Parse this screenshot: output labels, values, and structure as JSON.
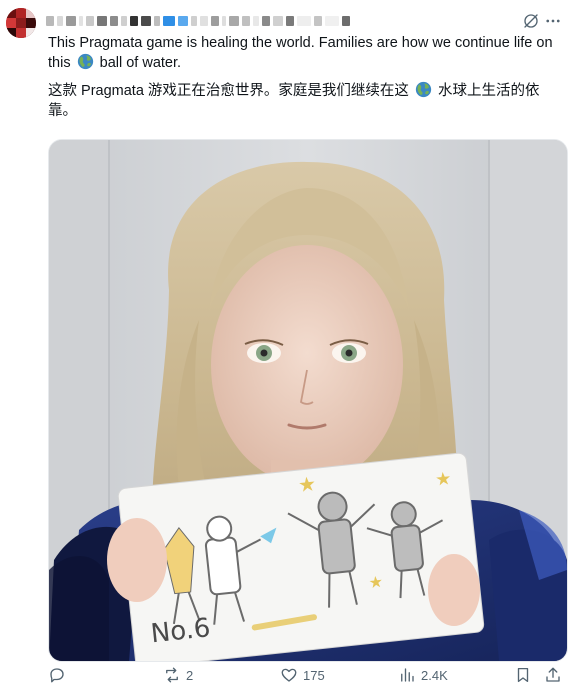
{
  "tweet": {
    "author_name_visible": false,
    "text_en_before_icon": "This Pragmata game is healing the world. Families are how we continue life on this",
    "text_en_after_icon": "ball of water.",
    "text_zh_before_icon": "这款 Pragmata 游戏正在治愈世界。家庭是我们继续在这",
    "text_zh_after_icon": "水球上生活的依靠。",
    "inline_icon": "globe-icon",
    "media": {
      "drawing_caption": "No.6"
    }
  },
  "actions": {
    "reply": {
      "icon": "reply-icon",
      "count": ""
    },
    "repost": {
      "icon": "repost-icon",
      "count": "2"
    },
    "like": {
      "icon": "heart-icon",
      "count": "175"
    },
    "views": {
      "icon": "views-icon",
      "count": "2.4K"
    },
    "bookmark": {
      "icon": "bookmark-icon"
    },
    "share": {
      "icon": "share-icon"
    }
  },
  "colors": {
    "text": "#0f1419",
    "muted": "#536471",
    "border": "#e6e9ec"
  }
}
